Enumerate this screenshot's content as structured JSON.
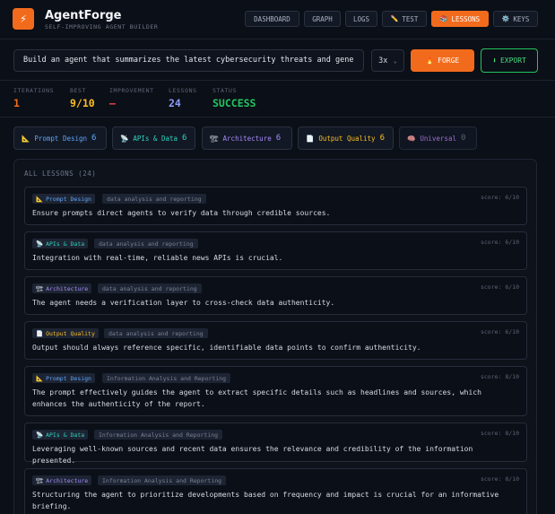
{
  "app": {
    "title": "AgentForge",
    "subtitle": "SELF-IMPROVING AGENT BUILDER",
    "logo_icon": "lightning-icon",
    "accent": "#f26b1d"
  },
  "nav": [
    {
      "label": "DASHBOARD",
      "icon": ""
    },
    {
      "label": "GRAPH",
      "icon": ""
    },
    {
      "label": "LOGS",
      "icon": ""
    },
    {
      "label": "TEST",
      "icon": "✏️"
    },
    {
      "label": "LESSONS",
      "icon": "📚",
      "active": true
    },
    {
      "label": "KEYS",
      "icon": "⚙️"
    }
  ],
  "prompt": {
    "value": "Build an agent that summarizes the latest cybersecurity threats and gene"
  },
  "multiplier": {
    "value": "3x"
  },
  "actions": {
    "forge": "FORGE",
    "forge_icon": "🔥",
    "export": "EXPORT",
    "export_icon": "⬇"
  },
  "stats": [
    {
      "label": "ITERATIONS",
      "value": "1",
      "color": "#f26b1d"
    },
    {
      "label": "BEST",
      "value": "9/10",
      "color": "#fbbf24"
    },
    {
      "label": "IMPROVEMENT",
      "value": "—",
      "color": "#ef4444"
    },
    {
      "label": "LESSONS",
      "value": "24",
      "color": "#8b9cf8"
    },
    {
      "label": "STATUS",
      "value": "SUCCESS",
      "color": "#22c55e"
    }
  ],
  "categories": [
    {
      "icon": "📐",
      "label": "Prompt Design",
      "count": "6",
      "color": "#60a5fa"
    },
    {
      "icon": "📡",
      "label": "APIs & Data",
      "count": "6",
      "color": "#2dd4bf"
    },
    {
      "icon": "🏗",
      "label": "Architecture",
      "count": "6",
      "color": "#a78bfa"
    },
    {
      "icon": "📄",
      "label": "Output Quality",
      "count": "6",
      "color": "#fbbf24"
    },
    {
      "icon": "🧠",
      "label": "Universal",
      "count": "0",
      "color": "#c084fc"
    }
  ],
  "lessons_panel": {
    "title": "ALL LESSONS (24)",
    "items": [
      {
        "tag": "Prompt Design",
        "icon": "📐",
        "color": "#60a5fa",
        "topic": "data analysis and reporting",
        "score": "score: 6/10",
        "text": "Ensure prompts direct agents to verify data through credible sources."
      },
      {
        "tag": "APIs & Data",
        "icon": "📡",
        "color": "#2dd4bf",
        "topic": "data analysis and reporting",
        "score": "score: 6/10",
        "text": "Integration with real-time, reliable news APIs is crucial."
      },
      {
        "tag": "Architecture",
        "icon": "🏗",
        "color": "#a78bfa",
        "topic": "data analysis and reporting",
        "score": "score: 6/10",
        "text": "The agent needs a verification layer to cross-check data authenticity."
      },
      {
        "tag": "Output Quality",
        "icon": "📄",
        "color": "#fbbf24",
        "topic": "data analysis and reporting",
        "score": "score: 6/10",
        "text": "Output should always reference specific, identifiable data points to confirm authenticity."
      },
      {
        "tag": "Prompt Design",
        "icon": "📐",
        "color": "#60a5fa",
        "topic": "Information Analysis and Reporting",
        "score": "score: 8/10",
        "text": "The prompt effectively guides the agent to extract specific details such as headlines and sources, which enhances the authenticity of the report."
      },
      {
        "tag": "APIs & Data",
        "icon": "📡",
        "color": "#2dd4bf",
        "topic": "Information Analysis and Reporting",
        "score": "score: 8/10",
        "text": "Leveraging well-known sources and recent data ensures the relevance and credibility of the information presented."
      },
      {
        "tag": "Architecture",
        "icon": "🏗",
        "color": "#a78bfa",
        "topic": "Information Analysis and Reporting",
        "score": "score: 8/10",
        "text": "Structuring the agent to prioritize developments based on frequency and impact is crucial for an informative briefing."
      }
    ]
  }
}
